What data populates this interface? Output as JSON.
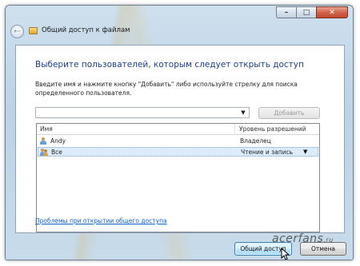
{
  "window": {
    "title": "Общий доступ к файлам"
  },
  "caption_buttons": {
    "minimize": "–",
    "maximize": "□",
    "close": "✕"
  },
  "nav": {
    "back_glyph": "←"
  },
  "main": {
    "heading": "Выберите пользователей, которым следует открыть доступ",
    "instructions": "Введите имя и нажмите кнопку \"Добавить\" либо используйте стрелку для поиска определенного пользователя.",
    "combo_value": "",
    "combo_arrow": "▼",
    "add_button": "Добавить"
  },
  "list": {
    "columns": [
      "Имя",
      "Уровень разрешений"
    ],
    "rows": [
      {
        "name": "Andy",
        "permission": "Владелец",
        "icon": "user-icon",
        "selected": false
      },
      {
        "name": "Все",
        "permission": "Чтение и запись",
        "icon": "group-icon",
        "selected": true,
        "dropdown": "▼"
      }
    ]
  },
  "footer": {
    "help_link": "Проблемы при открытии общего доступа",
    "share_button": "Общий доступ",
    "cancel_button": "Отмена"
  },
  "watermark": {
    "text": "acerfans",
    "suffix": ".ru"
  },
  "colors": {
    "heading": "#1e3f8c",
    "link": "#1060c8",
    "selection": "#dcecfc"
  }
}
